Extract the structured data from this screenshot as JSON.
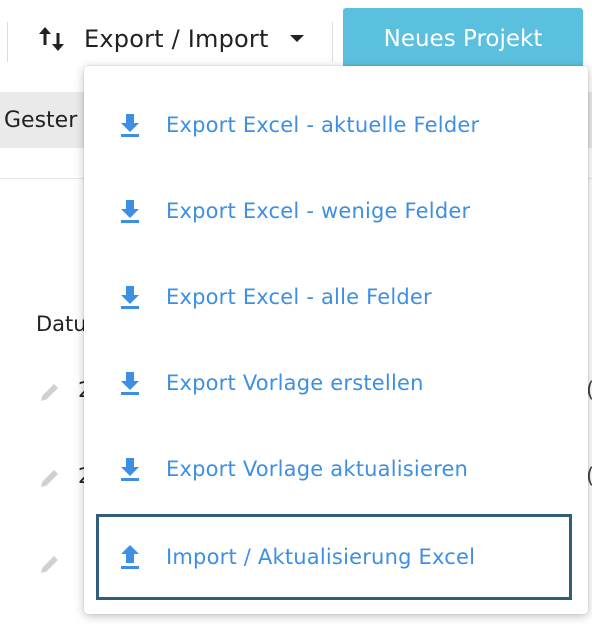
{
  "toolbar": {
    "export_import_label": "Export / Import",
    "sort_icon": "sort-up-down-icon",
    "caret_icon": "caret-down-icon",
    "new_project_label": "Neues Projekt",
    "new_project_color": "#5bc0de"
  },
  "band": {
    "text": "Gester"
  },
  "table": {
    "column_header": "Datu",
    "rows": [
      {
        "left": "2",
        "right": "("
      },
      {
        "left": "2",
        "right": "("
      },
      {
        "left": "",
        "right": ""
      }
    ]
  },
  "dropdown": {
    "link_color": "#3d8fe3",
    "highlight_border_color": "#2f5d7a",
    "items": [
      {
        "label": "Export Excel - aktuelle Felder",
        "icon": "download-icon"
      },
      {
        "label": "Export Excel - wenige Felder",
        "icon": "download-icon"
      },
      {
        "label": "Export Excel - alle Felder",
        "icon": "download-icon"
      },
      {
        "label": "Export Vorlage erstellen",
        "icon": "download-icon"
      },
      {
        "label": "Export Vorlage aktualisieren",
        "icon": "download-icon"
      },
      {
        "label": "Import / Aktualisierung Excel",
        "icon": "upload-icon",
        "highlighted": true
      }
    ]
  }
}
